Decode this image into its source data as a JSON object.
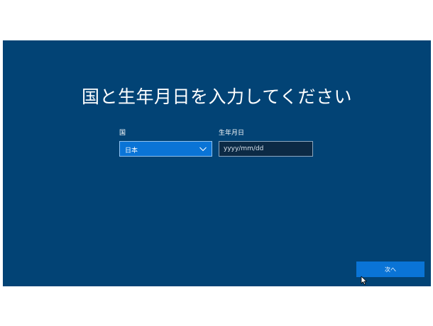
{
  "page": {
    "title": "国と生年月日を入力してください"
  },
  "form": {
    "country_label": "国",
    "country_value": "日本",
    "birthdate_label": "生年月日",
    "birthdate_placeholder": "yyyy/mm/dd",
    "birthdate_value": ""
  },
  "footer": {
    "next_label": "次へ"
  },
  "icons": {
    "dropdown": "chevron-down-icon",
    "pointer": "mouse-pointer-icon"
  },
  "colors": {
    "background": "#024375",
    "accent": "#0a74d6",
    "input_background": "#0c2a45",
    "text": "#ffffff"
  }
}
